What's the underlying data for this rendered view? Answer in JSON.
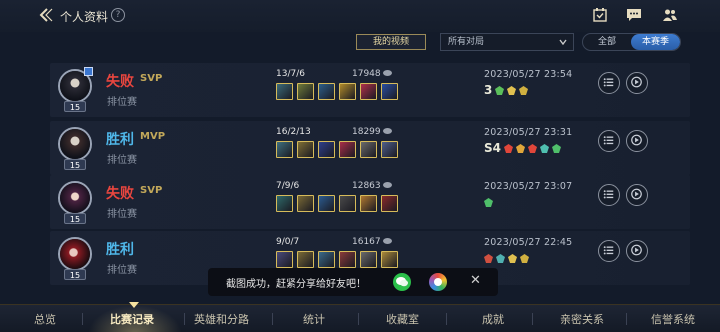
{
  "header": {
    "title": "个人资料",
    "help_glyph": "?"
  },
  "filters": {
    "my_videos": "我的视频",
    "match_type": "所有对局",
    "season_all": "全部",
    "season_current": "本赛季"
  },
  "matches": [
    {
      "result": "失败",
      "outcome": "loss",
      "badge": "SVP",
      "mode": "排位赛",
      "level": "15",
      "kda": "13/7/6",
      "gold": "17948",
      "date": "2023/05/27 23:54",
      "honor_text": "3",
      "items": [
        "#3b6b7a",
        "#6f7b3a",
        "#2d5f8a",
        "#b08a2a",
        "#b0304a",
        "#2a4ea0"
      ]
    },
    {
      "result": "胜利",
      "outcome": "win",
      "badge": "MVP",
      "mode": "排位赛",
      "level": "15",
      "kda": "16/2/13",
      "gold": "18299",
      "date": "2023/05/27 23:31",
      "honor_text": "S4",
      "items": [
        "#3f6f7e",
        "#7e6e35",
        "#2f3f8c",
        "#a82e48",
        "#6a6a6a",
        "#4f5f8a"
      ]
    },
    {
      "result": "失败",
      "outcome": "loss",
      "badge": "SVP",
      "mode": "排位赛",
      "level": "15",
      "kda": "7/9/6",
      "gold": "12863",
      "date": "2023/05/27 23:07",
      "honor_text": "",
      "items": [
        "#2f6a6a",
        "#7a6a36",
        "#2c5c90",
        "#4a4a4a",
        "#b07830",
        "#8a2a2a"
      ]
    },
    {
      "result": "胜利",
      "outcome": "win",
      "badge": "",
      "mode": "排位赛",
      "level": "15",
      "kda": "9/0/7",
      "gold": "16167",
      "date": "2023/05/27 22:45",
      "honor_text": "",
      "items": [
        "#4a4a7a",
        "#7a6a36",
        "#3a6a8a",
        "#8a3a3a",
        "#6a6a6a",
        "#aa8a3a"
      ]
    }
  ],
  "toast": {
    "message": "截图成功，赶紧分享给好友吧！",
    "close_glyph": "✕"
  },
  "bottom_nav": [
    "总览",
    "比赛记录",
    "英雄和分路",
    "统计",
    "收藏室",
    "成就",
    "亲密关系",
    "信誉系统"
  ],
  "colors": {
    "loss": "#e9463f",
    "win": "#4fb6e8",
    "svp_gold": "#c2a85a",
    "accent_blue": "#3e7cd0"
  },
  "icons": [
    "back-arrow-icon",
    "help-icon",
    "calendar-check-icon",
    "chat-icon",
    "friends-icon",
    "chevron-down-icon",
    "list-icon",
    "play-icon",
    "coin-icon",
    "wechat-icon",
    "moments-icon",
    "close-icon"
  ]
}
